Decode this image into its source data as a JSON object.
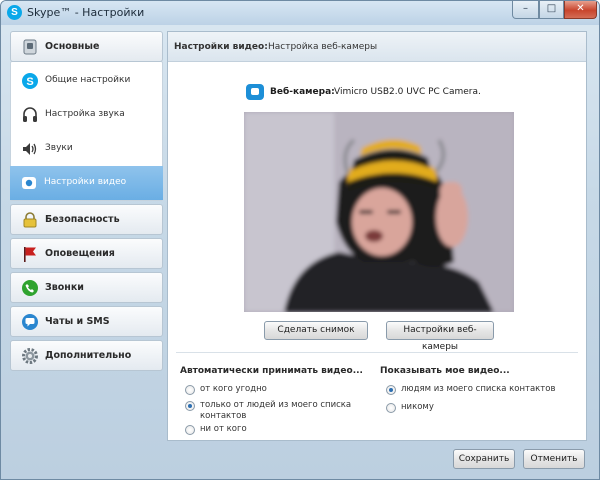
{
  "window": {
    "title": "Skype™ - Настройки"
  },
  "titlebar_buttons": {
    "minimize": "–",
    "maximize": "□",
    "close": "✕"
  },
  "sidebar": {
    "categories": [
      {
        "label": "Основные",
        "icon": "general-icon"
      },
      {
        "label": "Безопасность",
        "icon": "lock-icon"
      },
      {
        "label": "Оповещения",
        "icon": "flag-icon"
      },
      {
        "label": "Звонки",
        "icon": "phone-icon"
      },
      {
        "label": "Чаты и SMS",
        "icon": "chat-icon"
      },
      {
        "label": "Дополнительно",
        "icon": "gear-icon"
      }
    ],
    "sub_items": [
      {
        "label": "Общие настройки",
        "icon": "skype-icon"
      },
      {
        "label": "Настройка звука",
        "icon": "headset-icon"
      },
      {
        "label": "Звуки",
        "icon": "speaker-icon"
      },
      {
        "label": "Настройки видео",
        "icon": "webcam-icon",
        "active": true
      }
    ]
  },
  "panel": {
    "header_strong": "Настройки видео:",
    "header_normal": "Настройка веб-камеры",
    "webcam_label": "Веб-камера:",
    "webcam_value": "Vimicro USB2.0 UVC PC Camera.",
    "snapshot_button": "Сделать снимок",
    "webcam_settings_button": "Настройки веб-камеры",
    "auto_accept": {
      "title": "Автоматически принимать видео...",
      "options": [
        {
          "label": "от кого угодно",
          "selected": false
        },
        {
          "label": "только от людей из моего списка контактов",
          "selected": true
        },
        {
          "label": "ни от кого",
          "selected": false
        }
      ]
    },
    "show_video": {
      "title": "Показывать мое видео...",
      "options": [
        {
          "label": "людям из моего списка контактов",
          "selected": true
        },
        {
          "label": "никому",
          "selected": false
        }
      ]
    }
  },
  "footer": {
    "save": "Сохранить",
    "cancel": "Отменить"
  },
  "colors": {
    "accent": "#6aaee4",
    "skype_blue": "#0aa8ea",
    "close_red": "#c8452d"
  }
}
